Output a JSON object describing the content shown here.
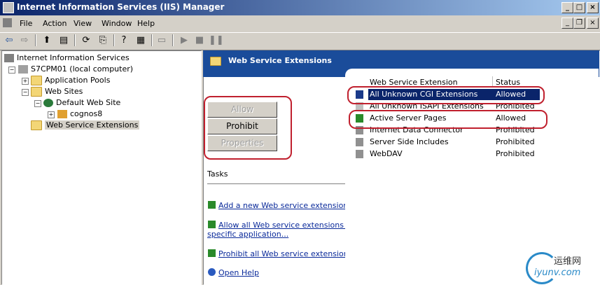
{
  "window": {
    "title": "Internet Information Services (IIS) Manager"
  },
  "menu": [
    "File",
    "Action",
    "View",
    "Window",
    "Help"
  ],
  "tree": {
    "root": "Internet Information Services",
    "computer": "S7CPM01 (local computer)",
    "app_pools": "Application Pools",
    "web_sites": "Web Sites",
    "default_site": "Default Web Site",
    "cognos": "cognos8",
    "wse": "Web Service Extensions"
  },
  "panel": {
    "title": "Web Service Extensions",
    "buttons": {
      "allow": "Allow",
      "prohibit": "Prohibit",
      "properties": "Properties"
    },
    "tasks_label": "Tasks",
    "tasks": [
      {
        "line1": "Add a new Web service extension...",
        "line2": ""
      },
      {
        "line1": "Allow all Web service extensions for a",
        "line2": "specific application..."
      },
      {
        "line1": "Prohibit all Web service extensions",
        "line2": ""
      },
      {
        "line1": "Open Help",
        "line2": ""
      }
    ]
  },
  "list": {
    "columns": {
      "name": "Web Service Extension",
      "status": "Status"
    },
    "rows": [
      {
        "name": "All Unknown CGI Extensions",
        "status": "Allowed"
      },
      {
        "name": "All Unknown ISAPI Extensions",
        "status": "Prohibited"
      },
      {
        "name": "Active Server Pages",
        "status": "Allowed"
      },
      {
        "name": "Internet Data Connector",
        "status": "Prohibited"
      },
      {
        "name": "Server Side Includes",
        "status": "Prohibited"
      },
      {
        "name": "WebDAV",
        "status": "Prohibited"
      }
    ]
  },
  "watermark": {
    "text1": "运维网",
    "text2": "iyunv.com"
  },
  "colors": {
    "title_dark": "#0a246a",
    "header_blue": "#1a4c9a",
    "highlight_red": "#c0202e",
    "link": "#0a2a9a"
  }
}
